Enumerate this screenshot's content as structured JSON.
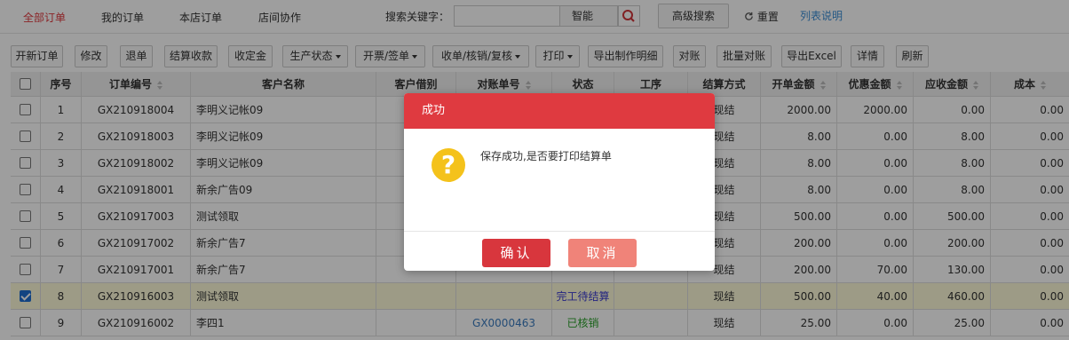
{
  "nav": {
    "tabs": [
      "全部订单",
      "我的订单",
      "本店订单",
      "店间协作"
    ],
    "search_label": "搜索关键字：",
    "search_value": "",
    "smart_label": "智能",
    "advanced_label": "高级搜索",
    "reset_label": "重置",
    "help_label": "列表说明"
  },
  "toolbar": {
    "buttons": [
      "开新订单",
      "修改",
      "退单",
      "结算收款",
      "收定金",
      "生产状态",
      "开票/签单",
      "收单/核销/复核",
      "打印",
      "导出制作明细",
      "对账",
      "批量对账",
      "导出Excel",
      "详情",
      "刷新"
    ]
  },
  "table": {
    "headers": [
      "序号",
      "订单编号",
      "客户名称",
      "客户借别",
      "对账单号",
      "状态",
      "工序",
      "结算方式",
      "开单金额",
      "优惠金额",
      "应收金额",
      "成本"
    ],
    "rows": [
      {
        "no": "1",
        "order": "GX210918004",
        "customer": "李明义记帐09",
        "statement": "",
        "status": "",
        "method": "现结",
        "amount": "2000.00",
        "discount": "2000.00",
        "receivable": "0.00",
        "cost": "0.00",
        "checked": false
      },
      {
        "no": "2",
        "order": "GX210918003",
        "customer": "李明义记帐09",
        "statement": "",
        "status": "",
        "method": "现结",
        "amount": "8.00",
        "discount": "0.00",
        "receivable": "8.00",
        "cost": "0.00",
        "checked": false
      },
      {
        "no": "3",
        "order": "GX210918002",
        "customer": "李明义记帐09",
        "statement": "",
        "status": "",
        "method": "现结",
        "amount": "8.00",
        "discount": "0.00",
        "receivable": "8.00",
        "cost": "0.00",
        "checked": false
      },
      {
        "no": "4",
        "order": "GX210918001",
        "customer": "新余广告09",
        "statement": "",
        "status": "",
        "method": "现结",
        "amount": "8.00",
        "discount": "0.00",
        "receivable": "8.00",
        "cost": "0.00",
        "checked": false
      },
      {
        "no": "5",
        "order": "GX210917003",
        "customer": "测试领取",
        "statement": "",
        "status": "",
        "method": "现结",
        "amount": "500.00",
        "discount": "0.00",
        "receivable": "500.00",
        "cost": "0.00",
        "checked": false
      },
      {
        "no": "6",
        "order": "GX210917002",
        "customer": "新余广告7",
        "statement": "",
        "status": "",
        "method": "现结",
        "amount": "200.00",
        "discount": "0.00",
        "receivable": "200.00",
        "cost": "0.00",
        "checked": false
      },
      {
        "no": "7",
        "order": "GX210917001",
        "customer": "新余广告7",
        "statement": "",
        "status": "",
        "method": "现结",
        "amount": "200.00",
        "discount": "70.00",
        "receivable": "130.00",
        "cost": "0.00",
        "checked": false
      },
      {
        "no": "8",
        "order": "GX210916003",
        "customer": "测试领取",
        "statement": "",
        "status": "完工待结算",
        "method": "现结",
        "amount": "500.00",
        "discount": "40.00",
        "receivable": "460.00",
        "cost": "0.00",
        "checked": true
      },
      {
        "no": "9",
        "order": "GX210916002",
        "customer": "李四1",
        "statement": "GX0000463",
        "status": "已核销",
        "method": "现结",
        "amount": "25.00",
        "discount": "0.00",
        "receivable": "25.00",
        "cost": "0.00",
        "checked": false
      }
    ]
  },
  "dialog": {
    "title": "成功",
    "icon": "?",
    "message": "保存成功,是否要打印结算单",
    "ok_label": "确认",
    "cancel_label": "取消"
  },
  "colors": {
    "accent": "#df3a40",
    "link": "#3b8ed6",
    "warning_icon": "#f4c21b"
  }
}
